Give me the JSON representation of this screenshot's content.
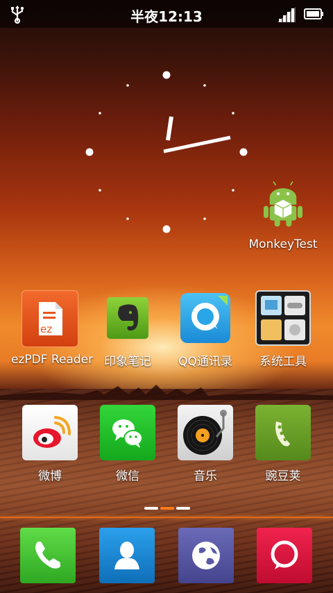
{
  "status_bar": {
    "time": "半夜12:13",
    "icons": [
      "usb-icon",
      "signal-icon",
      "battery-icon"
    ]
  },
  "clock_widget": {
    "type": "analog",
    "hour_angle_deg": 9,
    "minute_angle_deg": 75
  },
  "apps": [
    {
      "label": "MonkeyTest",
      "icon": "android-icon",
      "color": "#7cb342"
    },
    {
      "label": "ezPDF Reader",
      "icon": "ezpdf-icon",
      "color": "#e8551c"
    },
    {
      "label": "印象笔记",
      "icon": "evernote-icon",
      "color": "#6fb32a"
    },
    {
      "label": "QQ通讯录",
      "icon": "qq-contacts-icon",
      "color": "#2aa6e8"
    },
    {
      "label": "系统工具",
      "icon": "folder-icon",
      "color": "#2b2b2b"
    },
    {
      "label": "微博",
      "icon": "weibo-icon",
      "color": "#ffffff"
    },
    {
      "label": "微信",
      "icon": "wechat-icon",
      "color": "#22c22a"
    },
    {
      "label": "音乐",
      "icon": "music-icon",
      "color": "#e8e8e8"
    },
    {
      "label": "豌豆荚",
      "icon": "wandoujia-icon",
      "color": "#6aa22a"
    }
  ],
  "pager": {
    "pages": 3,
    "current": 2
  },
  "dock": [
    {
      "icon": "phone-icon",
      "color": "#45c935"
    },
    {
      "icon": "contacts-icon",
      "color": "#1a8bd6"
    },
    {
      "icon": "browser-icon",
      "color": "#5a5aa8"
    },
    {
      "icon": "messaging-icon",
      "color": "#e0153f"
    }
  ]
}
